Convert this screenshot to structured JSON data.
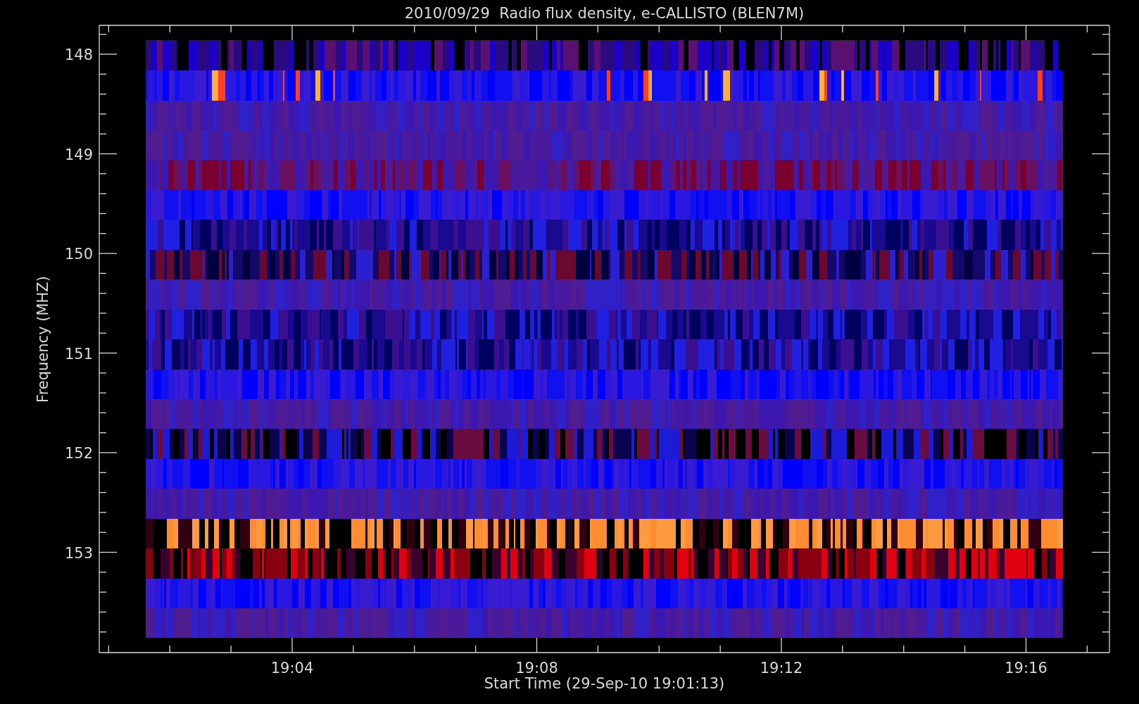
{
  "plot": {
    "title": "2010/09/29  Radio flux density, e-CALLISTO (BLEN7M)",
    "ylabel": "Frequency (MHZ)",
    "yticks": [
      "148",
      "149",
      "150",
      "151",
      "152",
      "153"
    ],
    "xlabel": "Start Time (29-Sep-10 19:01:13)",
    "xticks": [
      "19:04",
      "19:08",
      "19:12",
      "19:16"
    ]
  }
}
